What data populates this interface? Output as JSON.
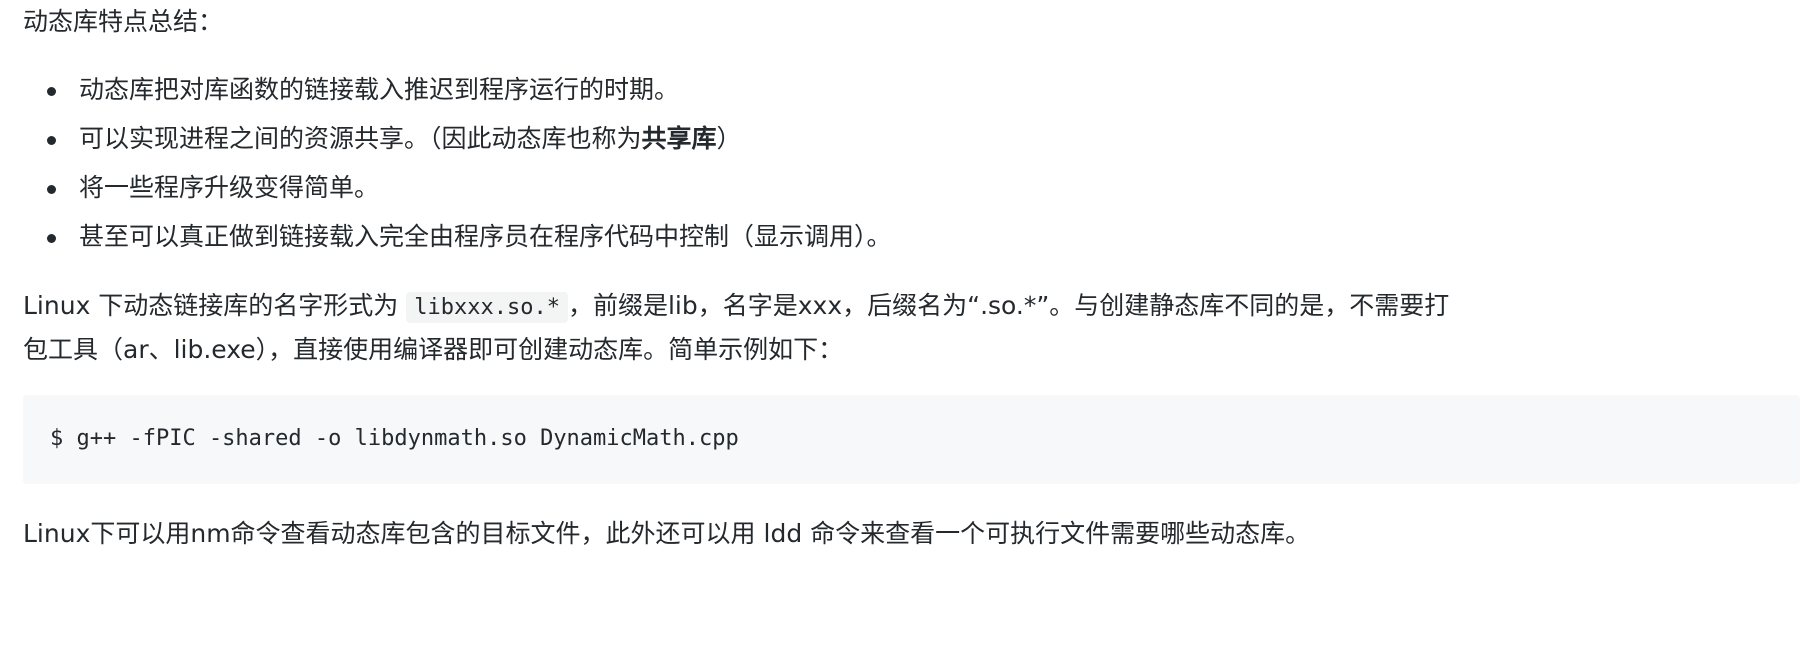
{
  "heading": "动态库特点总结：",
  "features": [
    {
      "text": "动态库把对库函数的链接载入推迟到程序运行的时期。",
      "strong": ""
    },
    {
      "text": "可以实现进程之间的资源共享。（因此动态库也称为",
      "strong": "共享库",
      "suffix": "）"
    },
    {
      "text": "将一些程序升级变得简单。",
      "strong": ""
    },
    {
      "text": "甚至可以真正做到链接载入完全由程序员在程序代码中控制（显示调用）。",
      "strong": ""
    }
  ],
  "para1": {
    "before": "Linux 下动态链接库的名字形式为 ",
    "code": "libxxx.so.*",
    "after": "，前缀是lib，名字是xxx，后缀名为“.so.*”。与创建静态库不同的是，不需要打",
    "line2": "包工具（ar、lib.exe），直接使用编译器即可创建动态库。简单示例如下："
  },
  "code_block": "$ g++ -fPIC -shared -o libdynmath.so DynamicMath.cpp",
  "para2": "Linux下可以用nm命令查看动态库包含的目标文件，此外还可以用 ldd 命令来查看一个可执行文件需要哪些动态库。"
}
